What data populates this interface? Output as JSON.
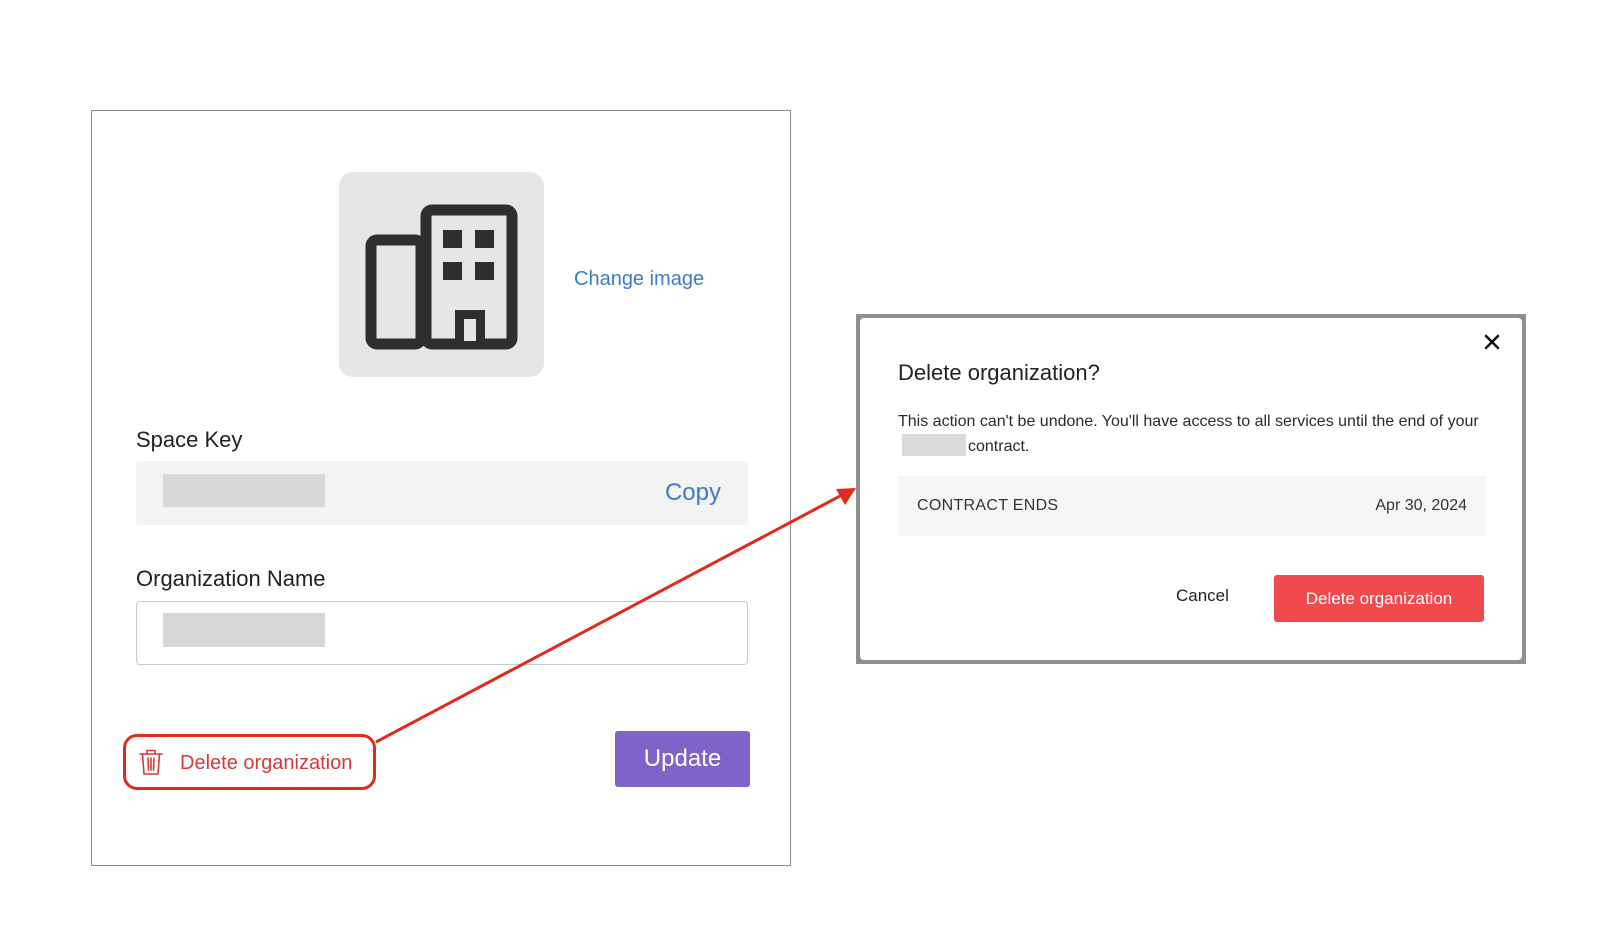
{
  "settings": {
    "change_image_label": "Change image",
    "space_key_label": "Space Key",
    "copy_label": "Copy",
    "org_name_label": "Organization Name",
    "delete_label": "Delete organization",
    "update_label": "Update"
  },
  "dialog": {
    "title": "Delete organization?",
    "message_part1": "This action can't be undone. You'll have access to all services until the end of your",
    "message_part2": "contract.",
    "contract_label": "CONTRACT ENDS",
    "contract_date": "Apr 30, 2024",
    "cancel_label": "Cancel",
    "confirm_label": "Delete organization"
  },
  "colors": {
    "link": "#3d7cc4",
    "danger": "#d33a3a",
    "danger_button": "#f04a4f",
    "primary_button": "#7f63c9",
    "annotation": "#e02a1d"
  },
  "icons": {
    "avatar": "building-icon",
    "delete": "trash-icon",
    "close": "close-icon"
  }
}
